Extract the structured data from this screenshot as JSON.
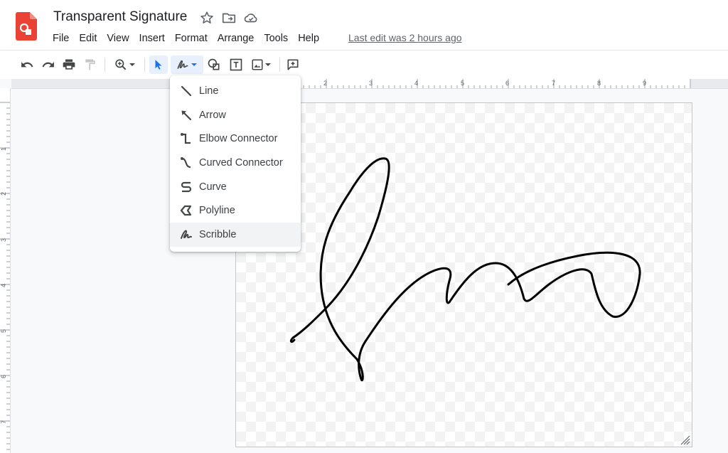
{
  "header": {
    "title": "Transparent Signature",
    "menu": [
      "File",
      "Edit",
      "View",
      "Insert",
      "Format",
      "Arrange",
      "Tools",
      "Help"
    ],
    "last_edit": "Last edit was 2 hours ago",
    "accent_color": "#ea4335"
  },
  "ruler": {
    "top_numbers": [
      "2",
      "3",
      "4",
      "5",
      "6",
      "7",
      "8",
      "9"
    ],
    "left_numbers": [
      "1",
      "2",
      "3",
      "4",
      "5",
      "6",
      "7"
    ]
  },
  "line_menu": {
    "items": [
      {
        "label": "Line",
        "icon": "line-icon"
      },
      {
        "label": "Arrow",
        "icon": "arrow-icon"
      },
      {
        "label": "Elbow Connector",
        "icon": "elbow-connector-icon"
      },
      {
        "label": "Curved Connector",
        "icon": "curved-connector-icon"
      },
      {
        "label": "Curve",
        "icon": "curve-icon"
      },
      {
        "label": "Polyline",
        "icon": "polyline-icon"
      },
      {
        "label": "Scribble",
        "icon": "scribble-icon"
      }
    ],
    "hovered": "Scribble"
  }
}
